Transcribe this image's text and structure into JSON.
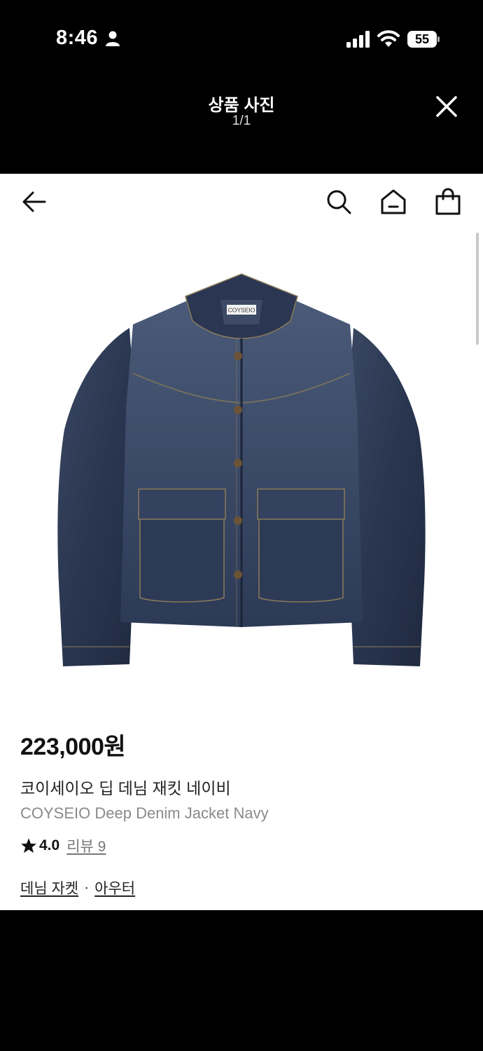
{
  "status_bar": {
    "time": "8:46",
    "battery": "55",
    "icons": [
      "person-icon",
      "signal-icon",
      "wifi-icon",
      "battery-icon"
    ]
  },
  "viewer": {
    "title": "상품 사진",
    "counter": "1/1",
    "close_icon": "close-icon"
  },
  "nav": {
    "icons": [
      "back-arrow-icon",
      "search-icon",
      "home-icon",
      "shopping-bag-icon"
    ]
  },
  "product_image": {
    "label_text": "COYSEIO",
    "color": "#2b3a55"
  },
  "product": {
    "price": "223,000원",
    "name_ko": "코이세이오 딥 데님 재킷 네이비",
    "name_en": "COYSEIO Deep Denim Jacket Navy",
    "rating": "4.0",
    "review_label": "리뷰 9",
    "categories": [
      "데님 자켓",
      "아우터"
    ],
    "category_separator": "·"
  }
}
